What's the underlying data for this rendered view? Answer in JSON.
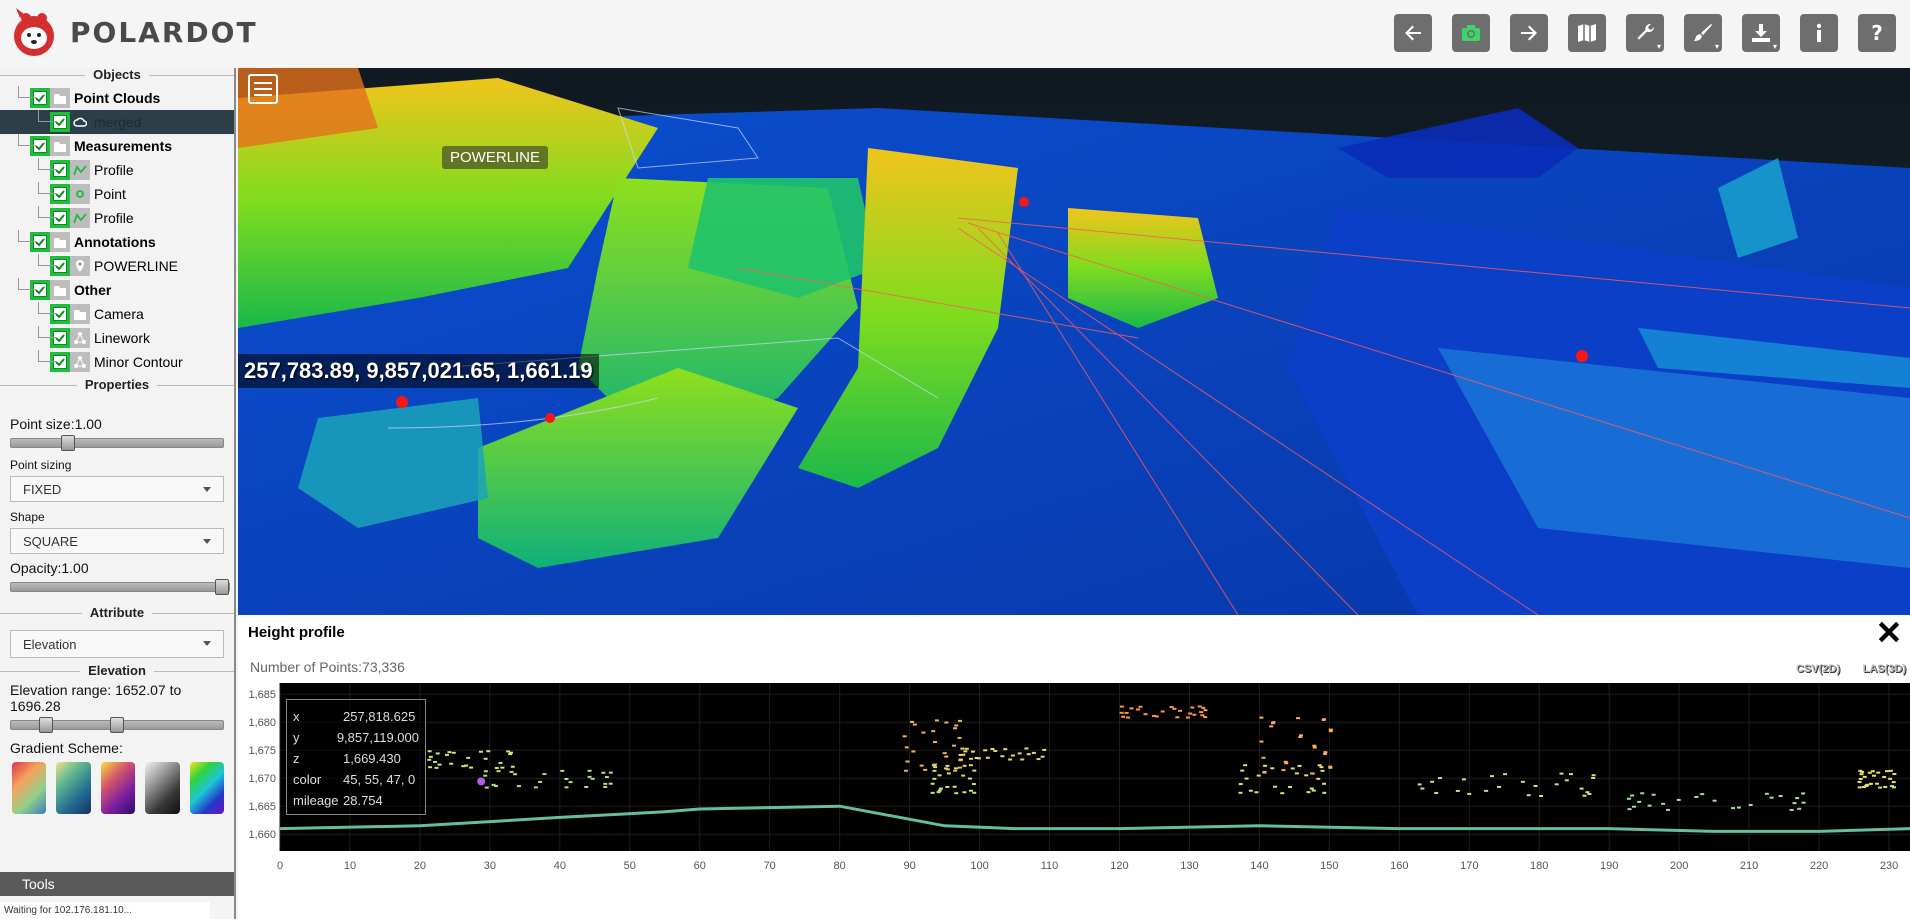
{
  "app": {
    "brand": "POLARDOT"
  },
  "toolbar": {
    "buttons": [
      {
        "name": "back-button",
        "icon": "arrow-left-icon"
      },
      {
        "name": "screenshot-button",
        "icon": "camera-icon"
      },
      {
        "name": "forward-button",
        "icon": "arrow-right-icon"
      },
      {
        "name": "map-button",
        "icon": "map-icon"
      },
      {
        "name": "tools-button",
        "icon": "wrench-icon"
      },
      {
        "name": "appearance-button",
        "icon": "brush-icon"
      },
      {
        "name": "download-button",
        "icon": "download-icon"
      },
      {
        "name": "info-button",
        "icon": "info-icon"
      },
      {
        "name": "help-button",
        "icon": "help-icon"
      }
    ]
  },
  "sidebar": {
    "objects_title": "Objects",
    "tree": [
      {
        "label": "Point Clouds",
        "bold": true,
        "level": 0,
        "icon": "folder-icon"
      },
      {
        "label": "merged",
        "bold": false,
        "level": 1,
        "icon": "cloud-icon",
        "selected": true
      },
      {
        "label": "Measurements",
        "bold": true,
        "level": 0,
        "icon": "folder-icon"
      },
      {
        "label": "Profile",
        "bold": false,
        "level": 1,
        "icon": "profile-icon"
      },
      {
        "label": "Point",
        "bold": false,
        "level": 1,
        "icon": "point-icon"
      },
      {
        "label": "Profile",
        "bold": false,
        "level": 1,
        "icon": "profile-icon"
      },
      {
        "label": "Annotations",
        "bold": true,
        "level": 0,
        "icon": "folder-icon"
      },
      {
        "label": "POWERLINE",
        "bold": false,
        "level": 1,
        "icon": "pin-icon"
      },
      {
        "label": "Other",
        "bold": true,
        "level": 0,
        "icon": "folder-icon"
      },
      {
        "label": "Camera",
        "bold": false,
        "level": 1,
        "icon": "folder-icon"
      },
      {
        "label": "Linework",
        "bold": false,
        "level": 1,
        "icon": "network-icon"
      },
      {
        "label": "Minor Contour",
        "bold": false,
        "level": 1,
        "icon": "network-icon"
      }
    ],
    "properties_title": "Properties",
    "point_size_label": "Point size:1.00",
    "point_size_value": 0.25,
    "point_sizing_label": "Point sizing",
    "point_sizing_value": "FIXED",
    "shape_label": "Shape",
    "shape_value": "SQUARE",
    "opacity_label": "Opacity:1.00",
    "opacity_value": 1.0,
    "attribute_title": "Attribute",
    "attribute_value": "Elevation",
    "elevation_title": "Elevation",
    "elevation_range_label": "Elevation range: 1652.07 to 1696.28",
    "elevation_range_low": 0.14,
    "elevation_range_high": 0.5,
    "gradient_label": "Gradient Scheme:",
    "tools_label": "Tools",
    "status_text": "Waiting for 102.176.181.10..."
  },
  "viewport": {
    "annotation": "POWERLINE",
    "coordinates": "257,783.89, 9,857,021.65, 1,661.19"
  },
  "profile": {
    "title": "Height profile",
    "num_points": "Number of Points:73,336",
    "export_csv": "CSV(2D)",
    "export_las": "LAS(3D)",
    "tooltip": {
      "x_label": "x",
      "x_value": "257,818.625",
      "y_label": "y",
      "y_value": "9,857,119.000",
      "z_label": "z",
      "z_value": "1,669.430",
      "color_label": "color",
      "color_value": "45, 55, 47, 0",
      "mileage_label": "mileage",
      "mileage_value": "28.754"
    }
  },
  "chart_data": {
    "type": "scatter",
    "title": "Height profile",
    "xlabel": "",
    "ylabel": "",
    "xlim": [
      0,
      233
    ],
    "ylim": [
      1657,
      1687
    ],
    "x_ticks": [
      0,
      10,
      20,
      30,
      40,
      50,
      60,
      70,
      80,
      90,
      100,
      110,
      120,
      130,
      140,
      150,
      160,
      170,
      180,
      190,
      200,
      210,
      220,
      230
    ],
    "y_ticks": [
      "1,660",
      "1,665",
      "1,670",
      "1,675",
      "1,680",
      "1,685"
    ],
    "y_tick_values": [
      1660,
      1665,
      1670,
      1675,
      1680,
      1685
    ],
    "grid": true,
    "series": [
      {
        "x": [
          0,
          20,
          40,
          55,
          60,
          80,
          95,
          105,
          120,
          140,
          160,
          175,
          190,
          205,
          220,
          233
        ],
        "y": [
          1661,
          1661.5,
          1663,
          1664,
          1664.5,
          1665,
          1661.5,
          1661,
          1661,
          1661.5,
          1661,
          1661,
          1661,
          1660.5,
          1660.5,
          1661
        ]
      }
    ]
  }
}
